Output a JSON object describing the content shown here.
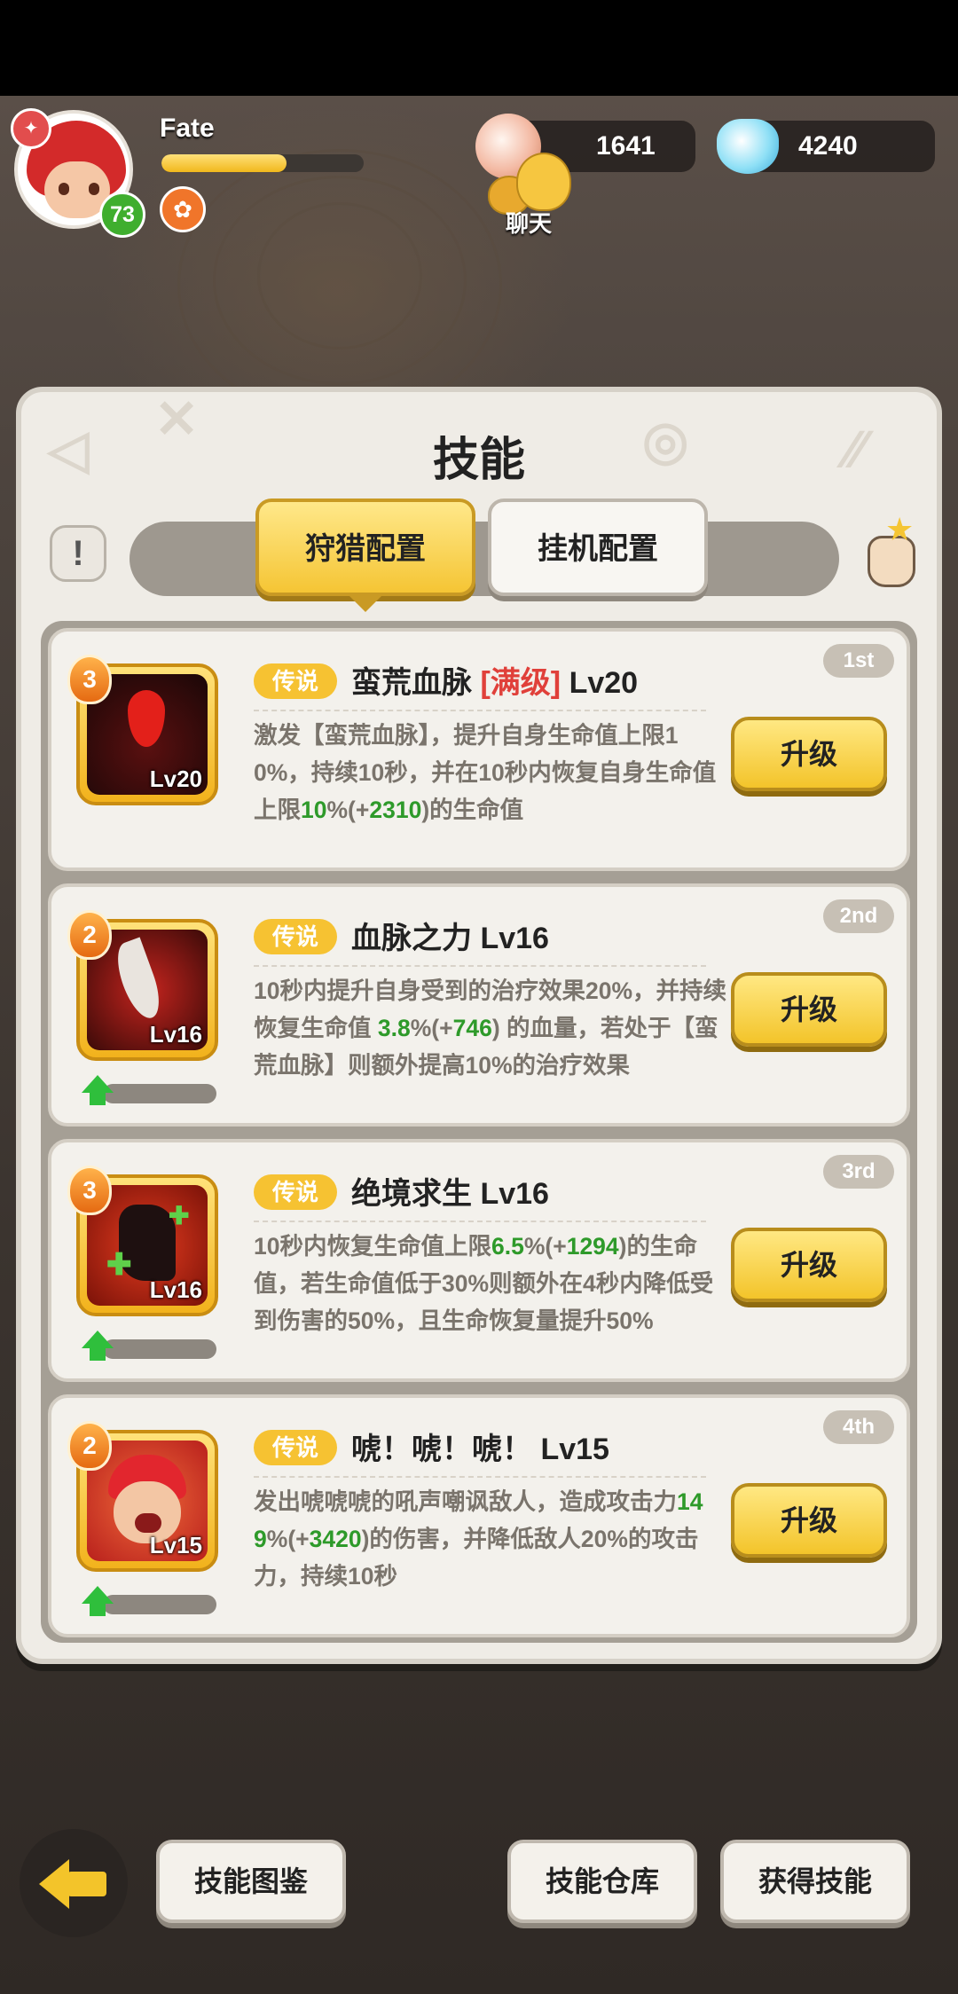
{
  "player": {
    "name": "Fate",
    "level": "73",
    "exp_fraction": 0.62
  },
  "currencies": [
    {
      "icon": "pearl-icon",
      "value": "1641"
    },
    {
      "icon": "crystal-icon",
      "value": "4240"
    }
  ],
  "chat": {
    "label": "聊天"
  },
  "panel": {
    "title": "技能",
    "info_glyph": "!",
    "tabs": [
      {
        "label": "狩猎配置",
        "active": true
      },
      {
        "label": "挂机配置",
        "active": false
      }
    ]
  },
  "skills": [
    {
      "rank": "1st",
      "stars": "3",
      "grade": "传说",
      "name": "蛮荒血脉",
      "maxed_tag": "[满级]",
      "level": "Lv20",
      "desc_parts": [
        "激发【蛮荒血脉】，提升自身生命值上限10%，持续10秒，并在10秒内恢复自身生命值上限",
        "10",
        "%(+",
        "2310",
        ")的生命值"
      ],
      "button": "升级",
      "art": "blood-drop-icon"
    },
    {
      "rank": "2nd",
      "stars": "2",
      "grade": "传说",
      "name": "血脉之力 Lv16",
      "level": "Lv16",
      "desc_parts": [
        "10秒内提升自身受到的治疗效果20%，并持续恢复生命值 ",
        "3.8",
        "%(+",
        "746",
        ") 的血量，若处于【蛮荒血脉】则额外提高10%的治疗效果"
      ],
      "button": "升级",
      "art": "claw-icon"
    },
    {
      "rank": "3rd",
      "stars": "3",
      "grade": "传说",
      "name": "绝境求生 Lv16",
      "level": "Lv16",
      "desc_parts": [
        "10秒内恢复生命值上限",
        "6.5",
        "%(+",
        "1294",
        ")的生命值，若生命值低于30%则额外在4秒内降低受到伤害的50%，且生命恢复量提升50%"
      ],
      "button": "升级",
      "art": "survivor-icon"
    },
    {
      "rank": "4th",
      "stars": "2",
      "grade": "传说",
      "name": "唬！唬！唬！ Lv15",
      "level": "Lv15",
      "desc_parts": [
        "发出唬唬唬的吼声嘲讽敌人，造成攻击力",
        "149",
        "%(+",
        "3420",
        ")的伤害，并降低敌人20%的攻击力，持续10秒"
      ],
      "button": "升级",
      "art": "roar-icon"
    }
  ],
  "bottom": {
    "codex": "技能图鉴",
    "warehouse": "技能仓库",
    "obtain": "获得技能"
  },
  "colors": {
    "accent": "#f3c42a",
    "highlight": "#2e9a2a",
    "maxed": "#e0403a"
  }
}
